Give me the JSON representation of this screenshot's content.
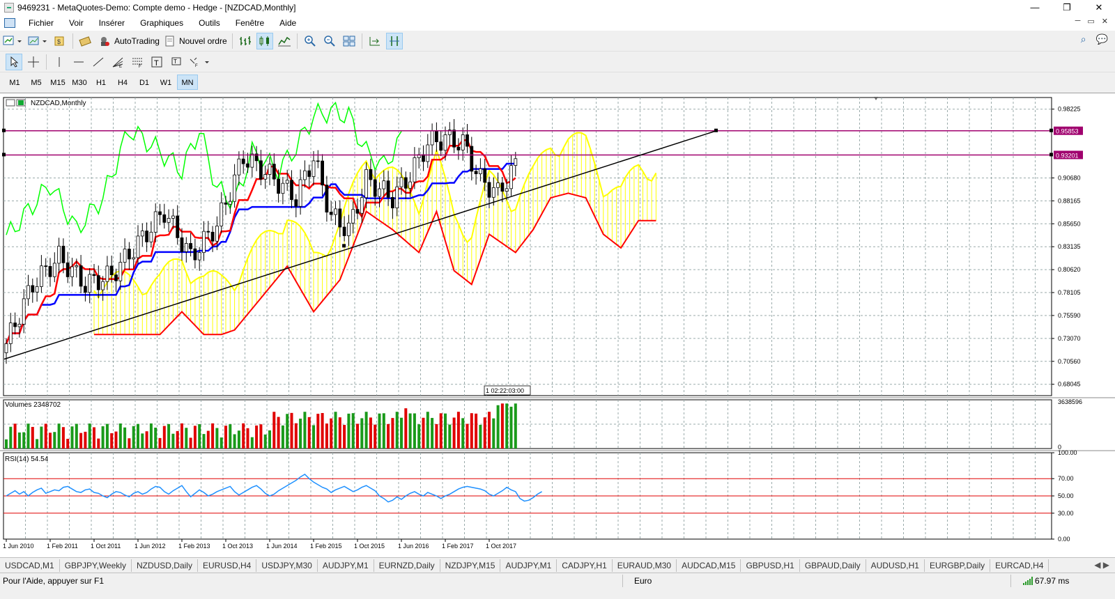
{
  "window": {
    "title": "9469231 - MetaQuotes-Demo: Compte demo - Hedge - [NZDCAD,Monthly]",
    "minimize": "—",
    "maximize": "❐",
    "close": "✕"
  },
  "menu": {
    "items": [
      "Fichier",
      "Voir",
      "Insérer",
      "Graphiques",
      "Outils",
      "Fenêtre",
      "Aide"
    ]
  },
  "toolbar": {
    "autotrading_label": "AutoTrading",
    "new_order_label": "Nouvel ordre"
  },
  "timeframes": [
    "M1",
    "M5",
    "M15",
    "M30",
    "H1",
    "H4",
    "D1",
    "W1",
    "MN"
  ],
  "active_timeframe": "MN",
  "chart": {
    "symbol_label": "NZDCAD,Monthly",
    "volumes_label": "Volumes 2348702",
    "rsi_label": "RSI(14) 54.54",
    "crosshair_time": "1 02:22:03:00",
    "colors": {
      "bull": "#000000",
      "tenkan": "#ff0000",
      "kijun": "#0000ff",
      "chikou": "#00ff00",
      "senkou_a": "#ffff00",
      "senkou_b": "#ff0000",
      "hline": "#a0006e",
      "rsi_line": "#1e90ff"
    }
  },
  "chart_data": {
    "type": "candlestick",
    "price_axis": {
      "ticks": [
        "0.98225",
        "0.95853",
        "0.93201",
        "0.90680",
        "0.88165",
        "0.85650",
        "0.83135",
        "0.80620",
        "0.78105",
        "0.75590",
        "0.73070",
        "0.70560",
        "0.68045"
      ],
      "range": [
        0.668,
        0.995
      ]
    },
    "time_axis": [
      "1 Jun 2010",
      "1 Feb 2011",
      "1 Oct 2011",
      "1 Jun 2012",
      "1 Feb 2013",
      "1 Oct 2013",
      "1 Jun 2014",
      "1 Feb 2015",
      "1 Oct 2015",
      "1 Jun 2016",
      "1 Feb 2017",
      "1 Oct 2017"
    ],
    "horizontal_lines": [
      0.95853,
      0.93201
    ],
    "volume_axis": {
      "max_label": "3638596",
      "min_label": "0"
    },
    "rsi_axis": {
      "ticks": [
        "100.00",
        "70.00",
        "50.00",
        "30.00",
        "0.00"
      ],
      "levels": [
        70,
        50,
        30
      ]
    },
    "rsi_values": [
      50,
      53,
      56,
      52,
      55,
      50,
      54,
      57,
      59,
      53,
      55,
      57,
      56,
      60,
      61,
      58,
      55,
      54,
      57,
      58,
      54,
      53,
      50,
      48,
      52,
      55,
      54,
      51,
      49,
      53,
      55,
      52,
      54,
      58,
      61,
      60,
      55,
      52,
      56,
      59,
      62,
      55,
      49,
      53,
      57,
      54,
      50,
      52,
      55,
      57,
      59,
      61,
      55,
      51,
      54,
      57,
      60,
      62,
      58,
      53,
      50,
      52,
      56,
      59,
      62,
      65,
      68,
      72,
      75,
      70,
      66,
      63,
      60,
      58,
      54,
      57,
      59,
      61,
      58,
      55,
      57,
      60,
      62,
      59,
      56,
      50,
      47,
      43,
      45,
      49,
      46,
      50,
      53,
      55,
      52,
      50,
      54,
      52,
      50,
      47,
      50,
      52,
      55,
      58,
      60,
      61,
      60,
      59,
      58,
      56,
      52,
      50,
      53,
      56,
      60,
      57,
      55,
      47,
      44,
      45,
      48,
      52,
      55
    ]
  },
  "tabs": [
    "USDCAD,M1",
    "GBPJPY,Weekly",
    "NZDUSD,Daily",
    "EURUSD,H4",
    "USDJPY,M30",
    "AUDJPY,M1",
    "EURNZD,Daily",
    "NZDJPY,M15",
    "AUDJPY,M1",
    "CADJPY,H1",
    "EURAUD,M30",
    "AUDCAD,M15",
    "GBPUSD,H1",
    "GBPAUD,Daily",
    "AUDUSD,H1",
    "EURGBP,Daily",
    "EURCAD,H4"
  ],
  "tab_arrows": "◀ ▶",
  "status": {
    "help": "Pour l'Aide, appuyer sur F1",
    "profile": "Euro",
    "connection": "67.97 ms"
  }
}
